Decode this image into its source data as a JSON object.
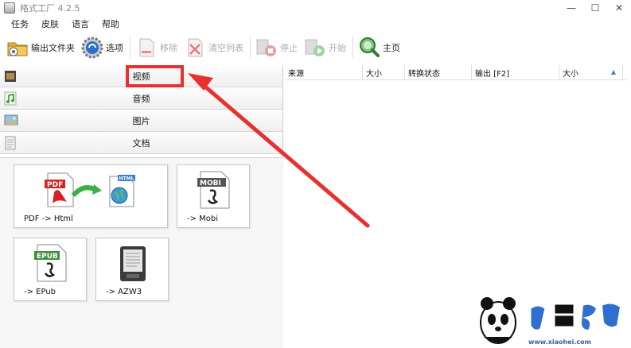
{
  "window": {
    "title": "格式工厂 4.2.5"
  },
  "menu": [
    "任务",
    "皮肤",
    "语言",
    "帮助"
  ],
  "toolbar": {
    "output_folder": "输出文件夹",
    "options": "选项",
    "remove": "移除",
    "clear_list": "清空列表",
    "stop": "停止",
    "start": "开始",
    "home": "主页"
  },
  "categories": [
    "视频",
    "音频",
    "图片",
    "文档"
  ],
  "tiles": [
    "PDF -> Html",
    "-> Mobi",
    "-> EPub",
    "-> AZW3"
  ],
  "tile_badges": {
    "pdf": "PDF",
    "html": "HTML",
    "mobi": "MOBI",
    "epub": "EPUB"
  },
  "table": {
    "columns": [
      "来源",
      "大小",
      "转换状态",
      "输出 [F2]",
      "大小"
    ]
  },
  "watermark": {
    "url": "www.xiaohei.com"
  },
  "colors": {
    "highlight": "#e8312f",
    "accent": "#4a7bc8"
  }
}
